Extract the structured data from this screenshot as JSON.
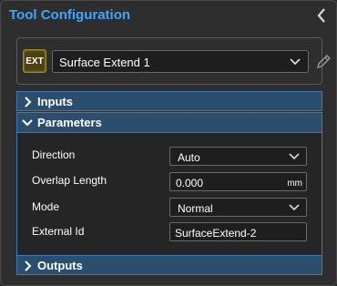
{
  "header": {
    "title": "Tool Configuration",
    "collapse_icon": "chevron-left-icon"
  },
  "tool": {
    "badge": "EXT",
    "selected": "Surface Extend 1",
    "dropdown_icon": "chevron-down-icon",
    "edit_icon": "pencil-icon"
  },
  "sections": {
    "inputs": {
      "label": "Inputs",
      "expanded": false
    },
    "parameters": {
      "label": "Parameters",
      "expanded": true
    },
    "outputs": {
      "label": "Outputs",
      "expanded": false
    }
  },
  "parameters": {
    "direction": {
      "label": "Direction",
      "value": "Auto"
    },
    "overlap_length": {
      "label": "Overlap Length",
      "value": "0.000",
      "unit": "mm"
    },
    "mode": {
      "label": "Mode",
      "value": "Normal"
    },
    "external_id": {
      "label": "External Id",
      "value": "SurfaceExtend-2"
    }
  },
  "colors": {
    "accent": "#3ea6ff",
    "section_header": "#2c4e6e",
    "section_border": "#3b7bb5",
    "badge": "#4a4216"
  }
}
